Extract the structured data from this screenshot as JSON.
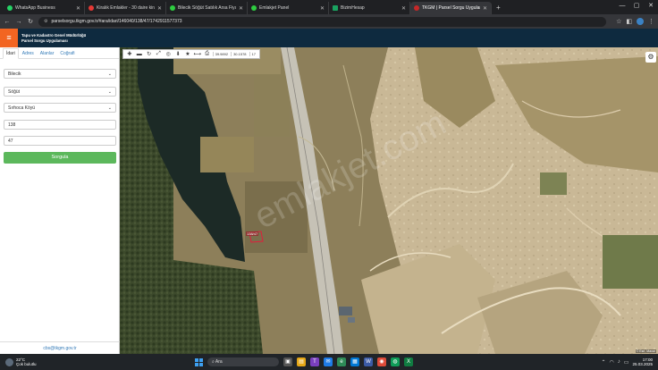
{
  "browser": {
    "tabs": [
      {
        "title": "WhatsApp Business",
        "color": "#25d366",
        "active": false
      },
      {
        "title": "Kiralık Emlakler - 30 daire kiralık",
        "color": "#e53935",
        "active": false
      },
      {
        "title": "Bilecik Söğüt Satılık Arsa Fiyatla",
        "color": "#2ecc40",
        "active": false
      },
      {
        "title": "Emlakjet Panel",
        "color": "#2ecc40",
        "active": false
      },
      {
        "title": "BizimHesap",
        "color": "#1aa260",
        "active": false
      },
      {
        "title": "TKGM | Parsel Sorgu Uygulaması",
        "color": "#c62828",
        "active": true
      }
    ],
    "url": "parselsorgu.tkgm.gov.tr/#ara/idari/146040/138/47/1742911577373"
  },
  "app": {
    "org_line1": "Tapu ve Kadastro Genel Müdürlüğü",
    "org_line2": "Parsel Sorgu Uygulaması",
    "accent": "#f26522"
  },
  "sidebar": {
    "tabs": [
      "İdari",
      "Adres",
      "Alanlar",
      "Coğrafi"
    ],
    "il": "Bilecik",
    "ilce": "Söğüt",
    "mahalle": "Sırhoca Köyü",
    "ada": "138",
    "parsel": "47",
    "submit": "Sorgula",
    "email": "cbs@tkgm.gov.tr"
  },
  "map": {
    "coord_x": "39.9892",
    "coord_y": "30.1578",
    "zoom": "17",
    "parcel_label": "138/47",
    "watermark": "emlakjet.com",
    "attribution": "© Esri, Maxar"
  },
  "taskbar": {
    "temp": "22°C",
    "weather": "Çok bulutlu",
    "search": "Ara",
    "time": "17:00",
    "date": "25.03.2025"
  }
}
